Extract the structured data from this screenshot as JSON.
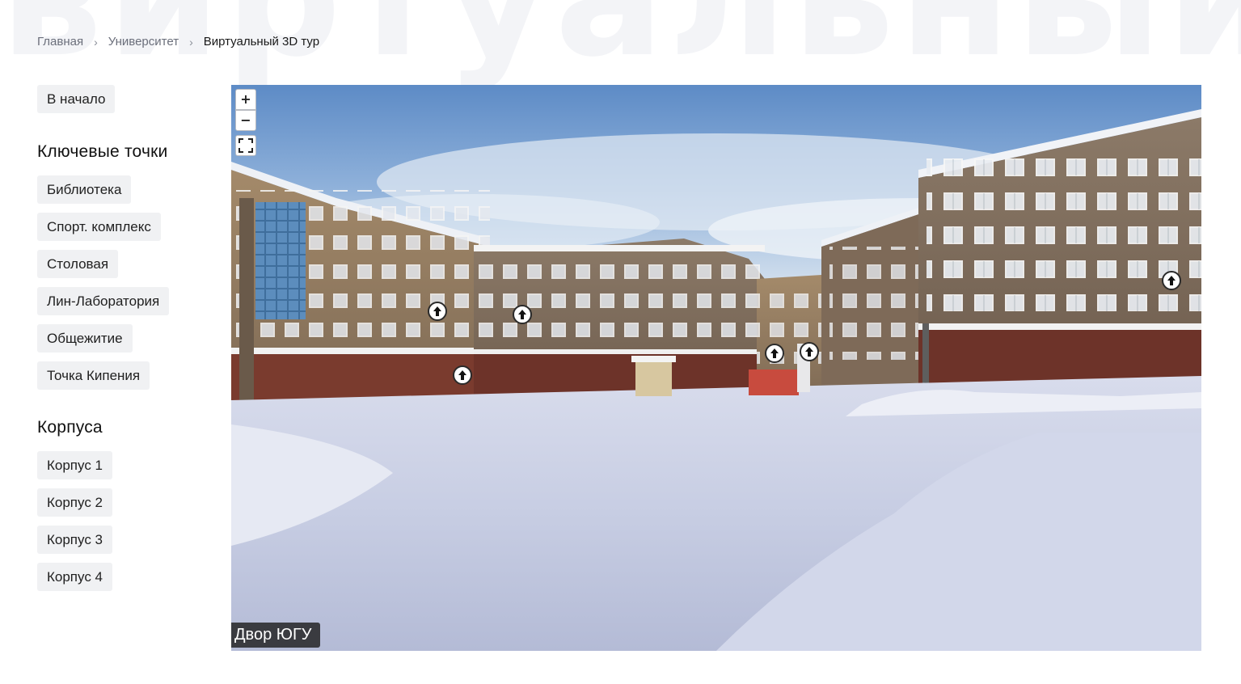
{
  "background_word": "виртуальный",
  "breadcrumb": {
    "items": [
      "Главная",
      "Университет"
    ],
    "current": "Виртуальный 3D тур"
  },
  "sidebar": {
    "start_button": "В начало",
    "key_points_title": "Ключевые точки",
    "key_points": [
      "Библиотека",
      "Спорт. комплекс",
      "Столовая",
      "Лин-Лаборатория",
      "Общежитие",
      "Точка Кипения"
    ],
    "buildings_title": "Корпуса",
    "buildings": [
      "Корпус 1",
      "Корпус 2",
      "Корпус 3",
      "Корпус 4"
    ]
  },
  "viewer": {
    "zoom_in": "+",
    "zoom_out": "−",
    "scene_title": "Двор ЮГУ",
    "hotspot_icon": "arrow-up-icon",
    "fullscreen_icon": "fullscreen-icon"
  }
}
